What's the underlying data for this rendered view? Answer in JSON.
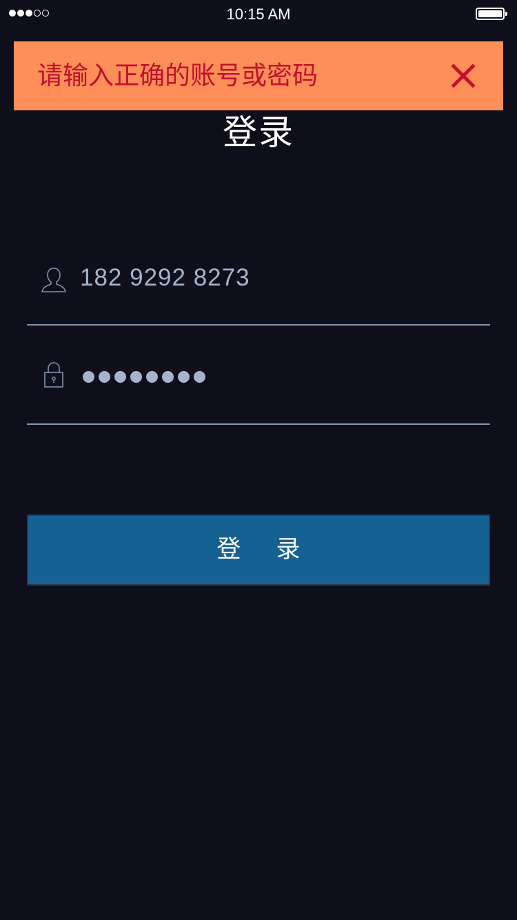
{
  "status_bar": {
    "time": "10:15 AM",
    "signal_strength_of_5": 3,
    "battery_level": 1.0
  },
  "page": {
    "title": "登录"
  },
  "toast": {
    "message": "请输入正确的账号或密码",
    "close_icon": "close-icon",
    "colors": {
      "background": "#ff8f59",
      "text": "#c4102c"
    }
  },
  "form": {
    "username": {
      "icon": "user-icon",
      "value": "182 9292 8273"
    },
    "password": {
      "icon": "lock-icon",
      "masked_length": 8
    },
    "submit_label": "登 录"
  },
  "colors": {
    "background": "#0f0f1c",
    "button": "#166194",
    "field_text": "#a7b3ca",
    "underline": "#8493ad"
  }
}
